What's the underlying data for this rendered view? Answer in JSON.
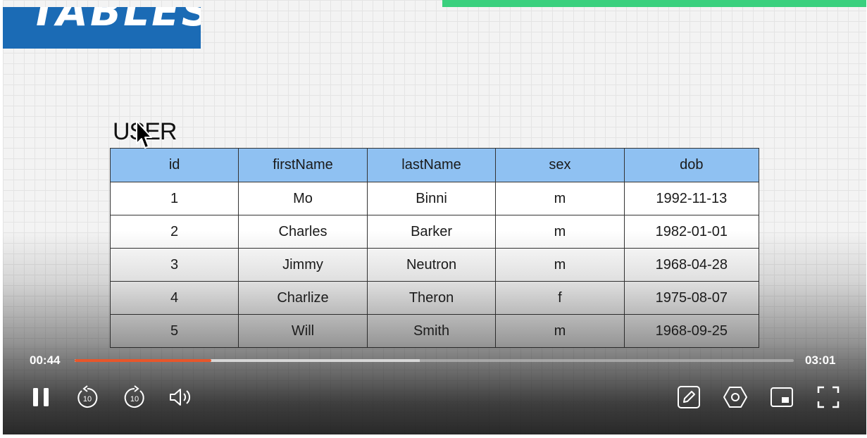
{
  "slide": {
    "banner_text": "TABLES",
    "table_caption": "USER",
    "table": {
      "headers": [
        "id",
        "firstName",
        "lastName",
        "sex",
        "dob"
      ],
      "rows": [
        [
          "1",
          "Mo",
          "Binni",
          "m",
          "1992-11-13"
        ],
        [
          "2",
          "Charles",
          "Barker",
          "m",
          "1982-01-01"
        ],
        [
          "3",
          "Jimmy",
          "Neutron",
          "m",
          "1968-04-28"
        ],
        [
          "4",
          "Charlize",
          "Theron",
          "f",
          "1975-08-07"
        ],
        [
          "5",
          "Will",
          "Smith",
          "m",
          "1968-09-25"
        ]
      ]
    }
  },
  "player": {
    "current_time": "00:44",
    "total_time": "03:01",
    "progress_fraction": 0.19,
    "buffered_fraction": 0.48,
    "controls": {
      "left": [
        "pause-icon",
        "rewind-10-icon",
        "forward-10-icon",
        "volume-icon"
      ],
      "right": [
        "pencil-icon",
        "settings-icon",
        "picture-in-picture-icon",
        "fullscreen-icon"
      ],
      "skip_seconds": "10"
    }
  },
  "colors": {
    "accent_progress": "#e8562a",
    "top_progress": "#3ad07e",
    "banner": "#1b6bb5",
    "table_header": "#8fc1f2"
  }
}
